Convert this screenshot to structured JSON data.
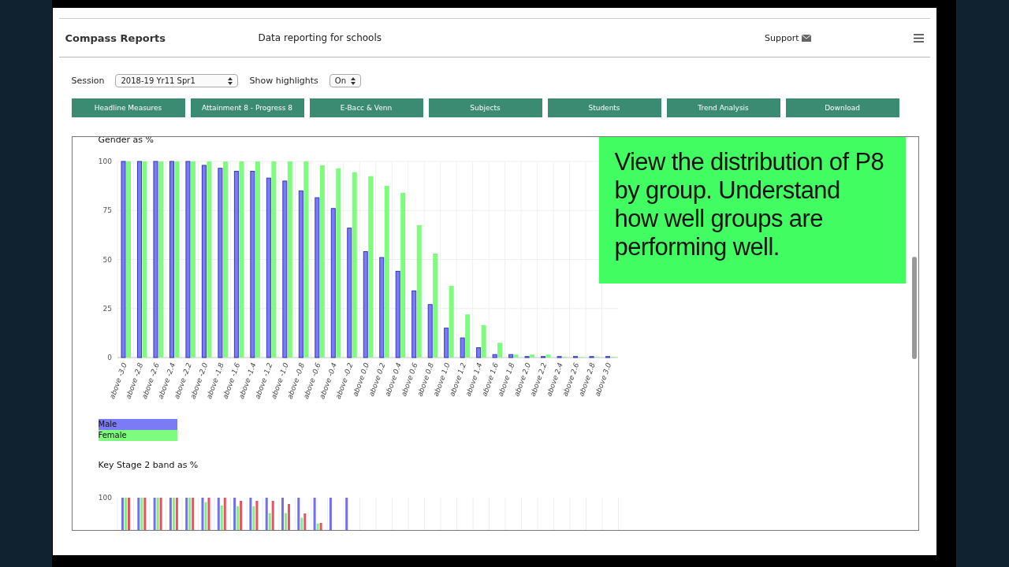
{
  "header": {
    "brand": "Compass Reports",
    "tagline": "Data reporting for schools",
    "support": "Support"
  },
  "controls": {
    "session_label": "Session",
    "session_value": "2018-19  Yr11  Spr1",
    "highlights_label": "Show highlights",
    "highlights_value": "On"
  },
  "nav_buttons": [
    "Headline Measures",
    "Attainment 8 - Progress 8",
    "E-Bacc & Venn",
    "Subjects",
    "Students",
    "Trend Analysis",
    "Download"
  ],
  "gender_chart": {
    "title": "Gender as %",
    "chart_data": {
      "type": "bar",
      "categories": [
        "above -3.0",
        "above -2.8",
        "above -2.6",
        "above -2.4",
        "above -2.2",
        "above -2.0",
        "above -1.8",
        "above -1.6",
        "above -1.4",
        "above -1.2",
        "above -1.0",
        "above -0.8",
        "above -0.6",
        "above -0.4",
        "above -0.2",
        "above 0.0",
        "above 0.2",
        "above 0.4",
        "above 0.6",
        "above 0.8",
        "above 1.0",
        "above 1.2",
        "above 1.4",
        "above 1.6",
        "above 1.8",
        "above 2.0",
        "above 2.2",
        "above 2.4",
        "above 2.6",
        "above 2.8",
        "above 3.0"
      ],
      "series": [
        {
          "name": "Male",
          "color": "#7b7bf5",
          "values": [
            100,
            100,
            100,
            100,
            100,
            98,
            96.5,
            95,
            95,
            91.5,
            90,
            85,
            81.5,
            76,
            66,
            54,
            51,
            44,
            34,
            27,
            15,
            10,
            5,
            1.5,
            1.5,
            0.5,
            0.5,
            0.5,
            0.5,
            0.5,
            0.5
          ]
        },
        {
          "name": "Female",
          "color": "#7dfc7d",
          "values": [
            100,
            100,
            100,
            100,
            100,
            100,
            100,
            100,
            100,
            100,
            100,
            100,
            98,
            96.5,
            94.5,
            92.5,
            87.5,
            84,
            67.5,
            53,
            36.5,
            22,
            16.5,
            7.5,
            1.5,
            1.5,
            1.5,
            0.3,
            0.3,
            0.3,
            0.3
          ]
        }
      ],
      "ylim": [
        0,
        100
      ],
      "yticks": [
        0,
        25,
        50,
        75,
        100
      ],
      "grid": true
    }
  },
  "callout": "View the distribution of P8 by group. Understand how well groups are performing well.",
  "ks2_chart": {
    "title": "Key Stage 2 band as %",
    "tick": "100"
  }
}
